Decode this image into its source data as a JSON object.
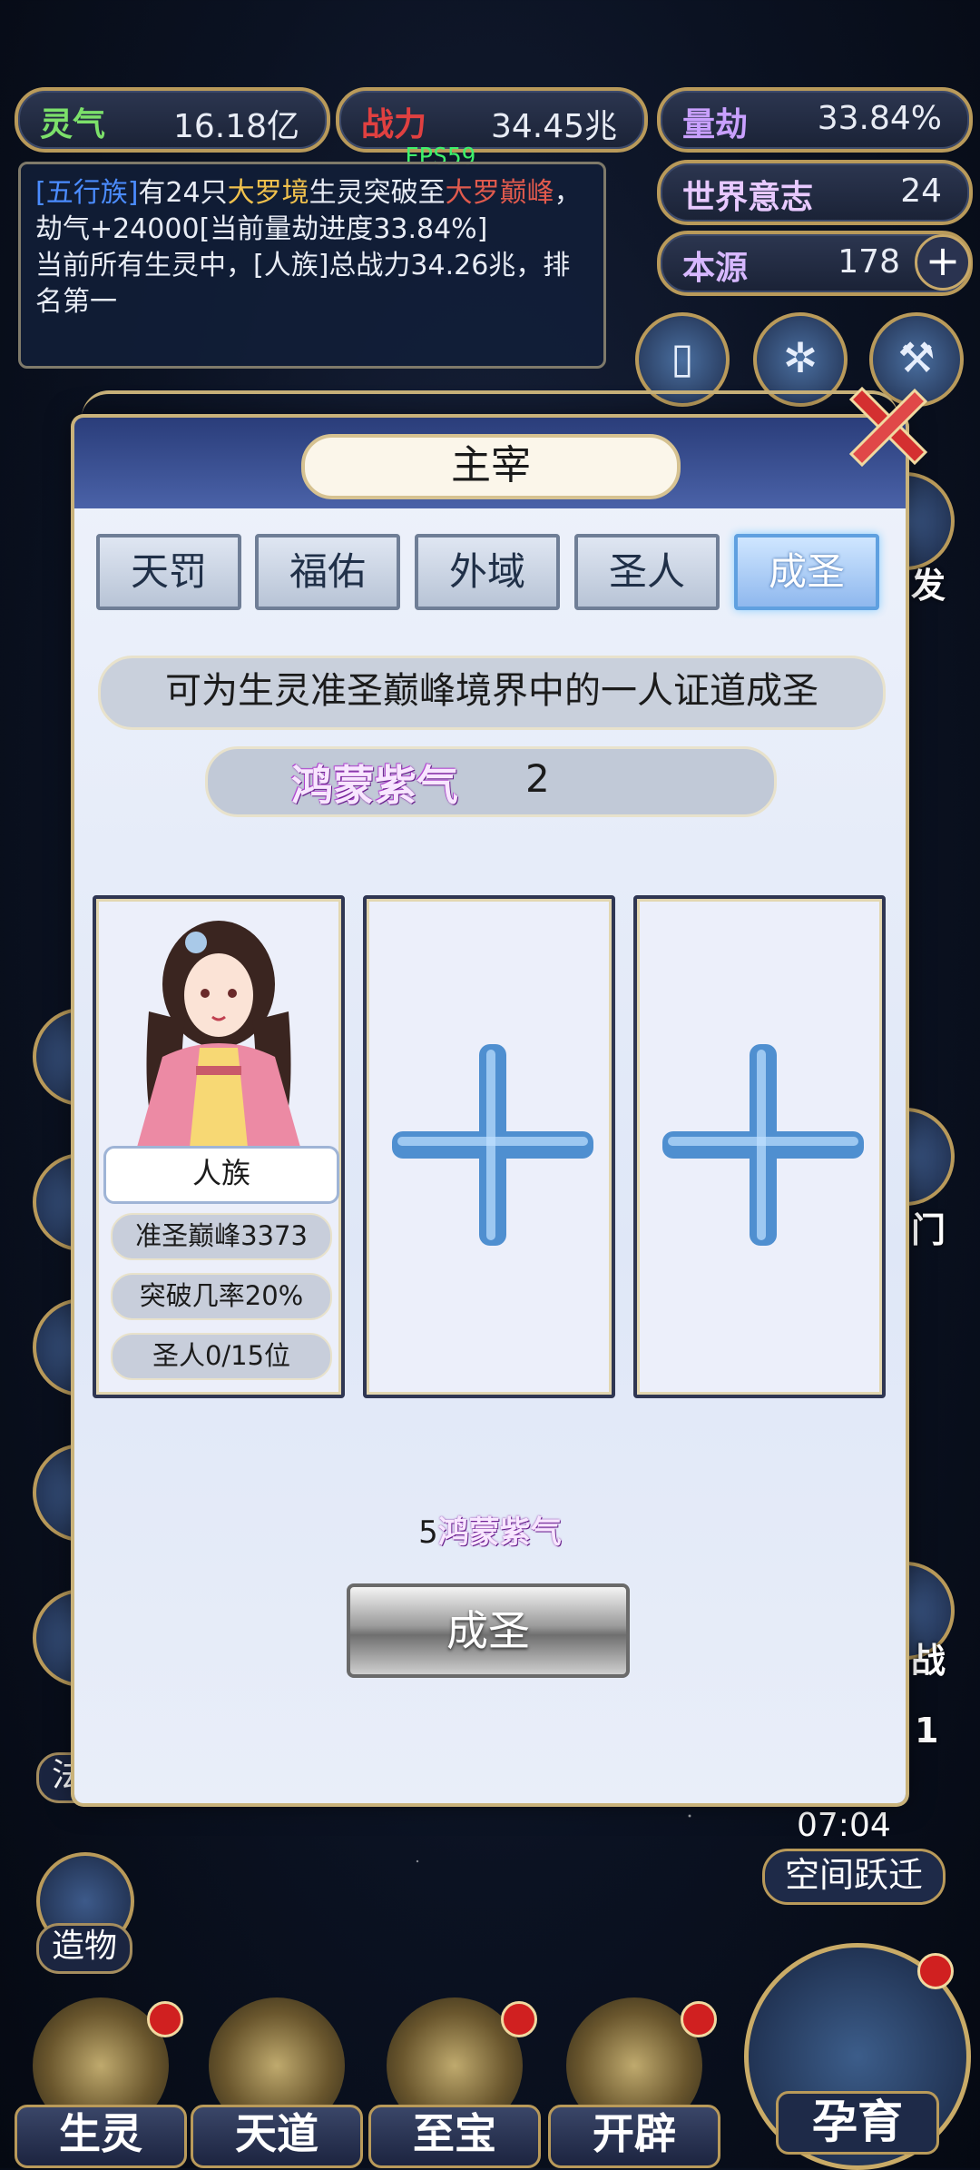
{
  "stats": {
    "lingqi": {
      "label": "灵气",
      "value": "16.18亿"
    },
    "zhanli": {
      "label": "战力",
      "value": "34.45兆"
    },
    "liangjie": {
      "label": "量劫",
      "value": "33.84%"
    },
    "shijie": {
      "label": "世界意志",
      "value": "24"
    },
    "benyuan": {
      "label": "本源",
      "value": "178"
    }
  },
  "fps": "FPS59",
  "log": {
    "line1_tribe": "[五行族]",
    "line1_a": "有24只",
    "line1_realm": "大罗境",
    "line1_b": "生灵突破至",
    "line1_peak": "大罗巅峰",
    "line1_c": "，劫气+24000[当前量劫进度33.84%]",
    "line2": "当前所有生灵中，[人族]总战力34.26兆，排名第一"
  },
  "side_labels": {
    "right_fa": "发",
    "right_men": "门",
    "right_zhan": "战",
    "right_badge": "1",
    "left_fa_ze": "法则",
    "left_zao_wu": "造物"
  },
  "timer": "07:04",
  "space_jump": "空间跃迁",
  "nav": [
    "生灵",
    "天道",
    "至宝",
    "开辟"
  ],
  "nav_big": "孕育",
  "modal": {
    "title": "主宰",
    "tabs": [
      "天罚",
      "福佑",
      "外域",
      "圣人",
      "成圣"
    ],
    "active_tab": 4,
    "description": "可为生灵准圣巅峰境界中的一人证道成圣",
    "qi_name": "鸿蒙紫气",
    "qi_count": "2",
    "card": {
      "race": "人族",
      "realm": "准圣巅峰3373",
      "chance": "突破几率20%",
      "saints": "圣人0/15位"
    },
    "cost_amount": "5",
    "cost_item": "鸿蒙紫气",
    "ascend_button": "成圣"
  },
  "colors": {
    "gold_border": "#b99a5a",
    "tribe_blue": "#4b8cff",
    "realm_gold": "#f0c14d",
    "peak_red": "#e05a4d",
    "fps_green": "#3ff06a"
  }
}
